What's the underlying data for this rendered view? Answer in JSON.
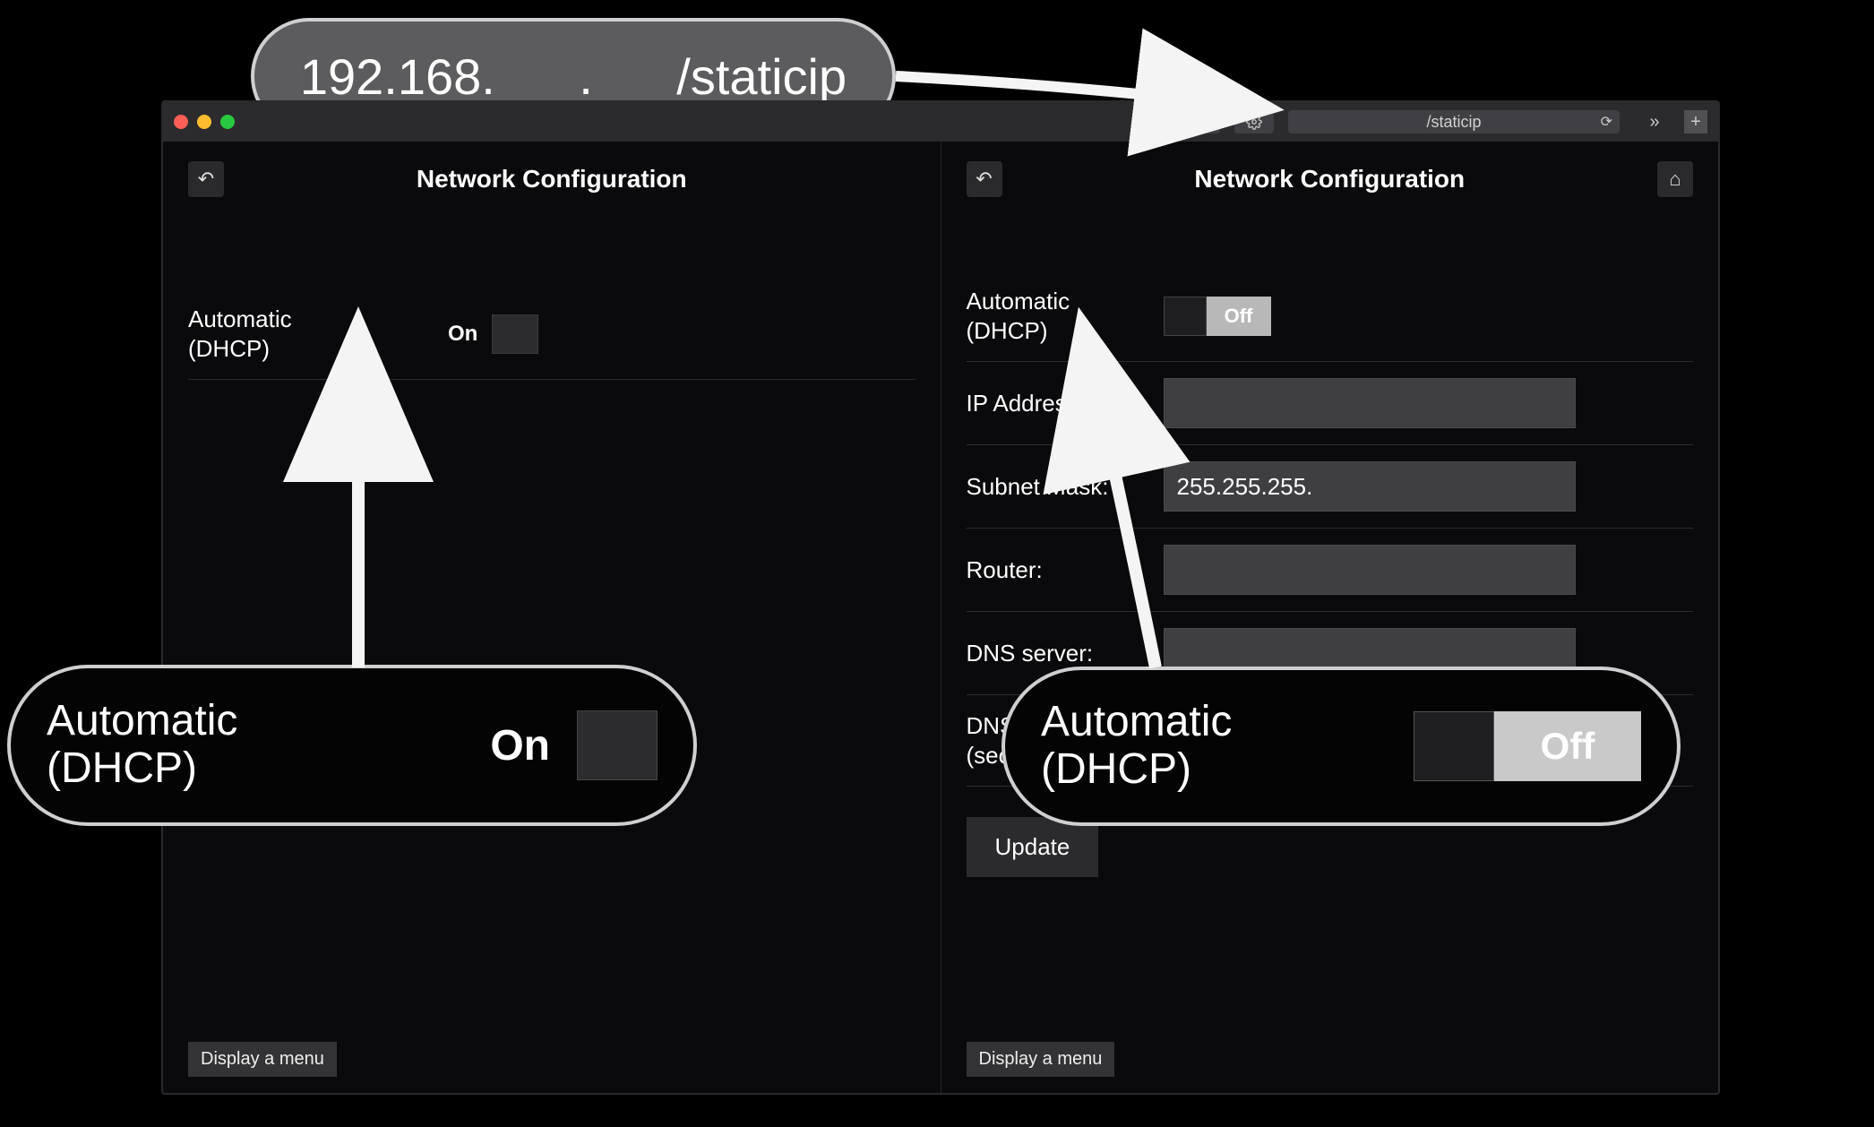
{
  "callouts": {
    "url_text": "192.168.___.___/staticip",
    "dhcp_label": "Automatic\n(DHCP)",
    "dhcp_on_status": "On",
    "dhcp_off_status": "Off"
  },
  "browser": {
    "url_fragment": "/staticip"
  },
  "panel_left": {
    "title": "Network Configuration",
    "dhcp_label": "Automatic (DHCP)",
    "dhcp_status": "On",
    "menu_button": "Display a menu"
  },
  "panel_right": {
    "title": "Network Configuration",
    "dhcp_label": "Automatic (DHCP)",
    "dhcp_status": "Off",
    "fields": {
      "ip_label": "IP Address:",
      "ip_value": "",
      "subnet_label": "Subnet Mask:",
      "subnet_value": "255.255.255.",
      "router_label": "Router:",
      "router_value": "",
      "dns_label": "DNS server:",
      "dns_value": "",
      "dns2_label": "DNS server (secondary):",
      "dns2_value": ""
    },
    "update_button": "Update",
    "menu_button": "Display a menu"
  }
}
